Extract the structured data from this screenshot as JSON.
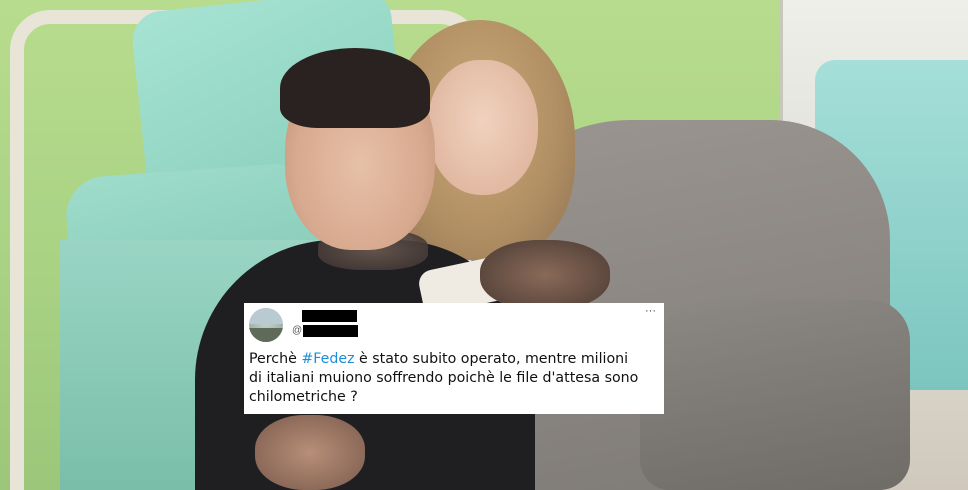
{
  "tweet": {
    "handle_prefix": "@",
    "more_label": "···",
    "text_line1_before": "Perchè ",
    "hashtag": "#Fedez",
    "text_line1_after": " è stato subito operato, mentre milioni",
    "text_line2": "di italiani muiono soffrendo poichè le file d'attesa sono",
    "text_line3": "chilometriche ?"
  },
  "colors": {
    "hashtag": "#1d8ed6",
    "card_bg": "#ffffff",
    "text": "#111111",
    "redaction": "#000000"
  },
  "icons": {
    "avatar": "profile-photo",
    "more": "more-options-icon"
  }
}
